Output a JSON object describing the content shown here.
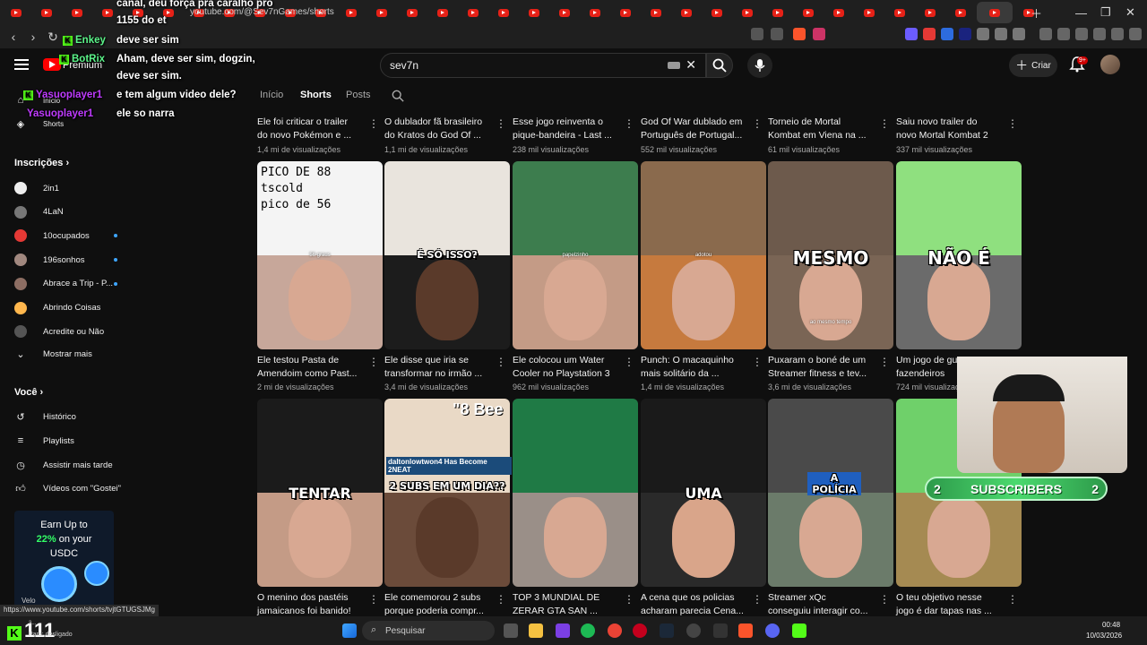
{
  "browser": {
    "url": "youtube.com/@Sev7nGames/shorts",
    "status_url": "https://www.youtube.com/shorts/tvjtGTUGSJMg"
  },
  "header": {
    "logo_label": "Premium",
    "search_value": "sev7n",
    "create_label": "Criar",
    "notif_badge": "9+"
  },
  "channel_tabs": [
    "Início",
    "Shorts",
    "Posts"
  ],
  "sidebar": {
    "top": [
      {
        "label": "Início",
        "icon": "home-icon"
      },
      {
        "label": "Shorts",
        "icon": "shorts-icon"
      }
    ],
    "subs_header": "Inscrições",
    "subscriptions": [
      {
        "label": "2in1",
        "dot": false
      },
      {
        "label": "4LaN",
        "dot": false
      },
      {
        "label": "10ocupados",
        "dot": true
      },
      {
        "label": "196sonhos",
        "dot": true
      },
      {
        "label": "Abrace a Trip - P...",
        "dot": true
      },
      {
        "label": "Abrindo Coisas",
        "dot": false
      },
      {
        "label": "Acredite ou Não",
        "dot": false
      }
    ],
    "show_more": "Mostrar mais",
    "you_header": "Você",
    "you_items": [
      {
        "label": "Histórico",
        "icon": "history-icon"
      },
      {
        "label": "Playlists",
        "icon": "playlists-icon"
      },
      {
        "label": "Assistir mais tarde",
        "icon": "watch-later-icon"
      },
      {
        "label": "Vídeos com \"Gostei\"",
        "icon": "thumbs-up-icon"
      }
    ]
  },
  "chat": {
    "lines": [
      {
        "user": "",
        "text": "canal, deu força pra caralho pro"
      },
      {
        "user": "",
        "text": "1155 do et"
      },
      {
        "user": "Enkey",
        "text": "deve ser sim"
      },
      {
        "user": "BotRix",
        "text": "Aham, deve ser sim, dogzin,"
      },
      {
        "user": "",
        "text": "deve ser sim."
      },
      {
        "user": "Yasuoplayer1",
        "text": "e tem algum video dele?"
      },
      {
        "user": "Yasuoplayer1",
        "text": "ele so narra"
      }
    ]
  },
  "row_top": [
    {
      "title1": "Ele foi criticar o trailer",
      "title2": "do novo Pokémon e ...",
      "views": "1,4 mi de visualizações"
    },
    {
      "title1": "O dublador fã brasileiro",
      "title2": "do Kratos do God Of ...",
      "views": "1,1 mi de visualizações"
    },
    {
      "title1": "Esse jogo reinventa o",
      "title2": "pique-bandeira - Last ...",
      "views": "238 mil visualizações"
    },
    {
      "title1": "God Of War dublado em",
      "title2": "Português de Portugal...",
      "views": "552 mil visualizações"
    },
    {
      "title1": "Torneio de Mortal",
      "title2": "Kombat em Viena na ...",
      "views": "61 mil visualizações"
    },
    {
      "title1": "Saiu novo trailer do",
      "title2": "novo Mortal Kombat 2",
      "views": "337 mil visualizações"
    }
  ],
  "row_mid": [
    {
      "title1": "Ele testou Pasta de",
      "title2": "Amendoim como Past...",
      "views": "2 mi de visualizações",
      "overlay": "",
      "top_text": "PICO DE 88\ntscold\npico de 56"
    },
    {
      "title1": "Ele disse que iria se",
      "title2": "transformar no irmão ...",
      "views": "3,4 mi de visualizações",
      "overlay": "É SÓ ISSO?",
      "top_text": ""
    },
    {
      "title1": "Ele colocou um Water",
      "title2": "Cooler no Playstation 3",
      "views": "962 mil visualizações",
      "overlay": "",
      "top_text": ""
    },
    {
      "title1": "Punch: O macaquinho",
      "title2": "mais solitário da ...",
      "views": "1,4 mi de visualizações",
      "overlay": "",
      "top_text": ""
    },
    {
      "title1": "Puxaram o boné de um",
      "title2": "Streamer fitness e tev...",
      "views": "3,6 mi de visualizações",
      "overlay": "MESMO",
      "top_text": ""
    },
    {
      "title1": "Um jogo de guerra entre",
      "title2": "fazendeiros",
      "views": "724 mil visualizações",
      "overlay": "NÃO É",
      "top_text": ""
    }
  ],
  "row_bot": [
    {
      "title1": "O menino dos pastéis",
      "title2": "jamaicanos foi banido!",
      "overlay": "TENTAR"
    },
    {
      "title1": "Ele comemorou 2 subs",
      "title2": "porque poderia compr...",
      "overlay": "2 SUBS EM UM DIA??"
    },
    {
      "title1": "TOP 3 MUNDIAL DE",
      "title2": "ZERAR GTA SAN ...",
      "overlay": ""
    },
    {
      "title1": "A cena que os policias",
      "title2": "acharam parecia Cena...",
      "overlay": "UMA"
    },
    {
      "title1": "Streamer xQc",
      "title2": "conseguiu interagir co...",
      "overlay": "A POLÍCIA"
    },
    {
      "title1": "O teu objetivo nesse",
      "title2": "jogo é dar tapas nas ...",
      "overlay": ""
    }
  ],
  "thumb_small_labels": [
    "56 graus",
    "papelzinho",
    "adotou",
    "ao mesmo tempo",
    "BREAKING NEWS",
    "daltonlowtwon4 Has Become 2NEAT",
    "\"8 Bee"
  ],
  "ad": {
    "line1": "Earn Up to",
    "pct": "22%",
    "line2": " on your",
    "line3": "USDC",
    "brand": "Velo"
  },
  "overlay_subs": {
    "left": "2",
    "label": "SUBSCRIBERS",
    "right": "2"
  },
  "taskbar": {
    "search": "Pesquisar",
    "time": "00:48",
    "date": "10/03/2026",
    "kick_number": "111",
    "kick_sub1": "3...",
    "kick_sub2": "Para: desligado"
  },
  "colors": {
    "bg": "#0f0f0f",
    "accent_red": "#ff0000",
    "kick_green": "#53fc18",
    "chip_blue": "#3ea6ff"
  }
}
